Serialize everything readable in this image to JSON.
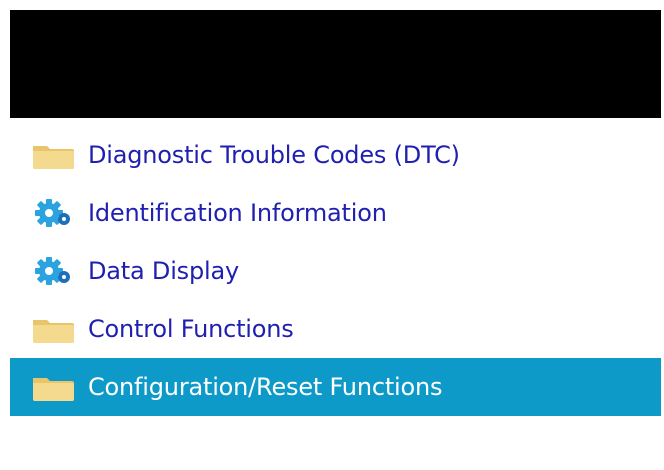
{
  "colors": {
    "header_bar": "#000000",
    "link_text": "#1f1fb0",
    "selected_background": "#0e9ac9",
    "selected_text": "#ffffff",
    "folder_fill": "#f1d27a",
    "gear_fill": "#2aa3e0"
  },
  "menu": {
    "items": [
      {
        "label": "Diagnostic Trouble Codes (DTC)",
        "icon": "folder-icon",
        "selected": false
      },
      {
        "label": "Identification Information",
        "icon": "gear-icon",
        "selected": false
      },
      {
        "label": "Data Display",
        "icon": "gear-icon",
        "selected": false
      },
      {
        "label": "Control Functions",
        "icon": "folder-icon",
        "selected": false
      },
      {
        "label": "Configuration/Reset Functions",
        "icon": "folder-icon",
        "selected": true
      }
    ]
  }
}
